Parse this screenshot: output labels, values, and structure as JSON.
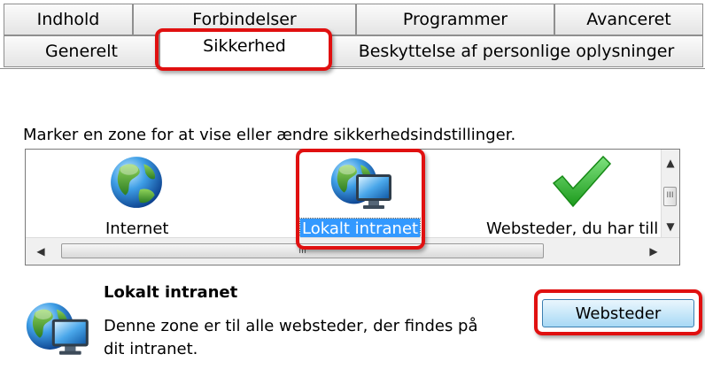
{
  "tabs": {
    "row1": [
      "Indhold",
      "Forbindelser",
      "Programmer",
      "Avanceret"
    ],
    "row2": [
      "Generelt",
      "Sikkerhed",
      "Beskyttelse af personlige oplysninger"
    ],
    "active": "Sikkerhed"
  },
  "security": {
    "instruction": "Marker en zone for at vise eller ændre sikkerhedsindstillinger.",
    "zones": [
      {
        "label": "Internet",
        "icon": "globe-icon"
      },
      {
        "label": "Lokalt intranet",
        "icon": "intranet-icon",
        "selected": true
      },
      {
        "label": "Websteder, du har till",
        "icon": "checkmark-icon"
      }
    ],
    "selected_zone": {
      "title": "Lokalt intranet",
      "description": "Denne zone er til alle websteder, der findes på dit intranet.",
      "icon": "intranet-icon"
    },
    "sites_button": "Websteder"
  },
  "scrollbars": {
    "up_glyph": "▲",
    "down_glyph": "▼",
    "left_glyph": "◀",
    "right_glyph": "▶",
    "grip_glyph": "III"
  },
  "colors": {
    "highlight": "#e01010",
    "selection": "#3399ff",
    "checkmark": "#2fb52f"
  }
}
